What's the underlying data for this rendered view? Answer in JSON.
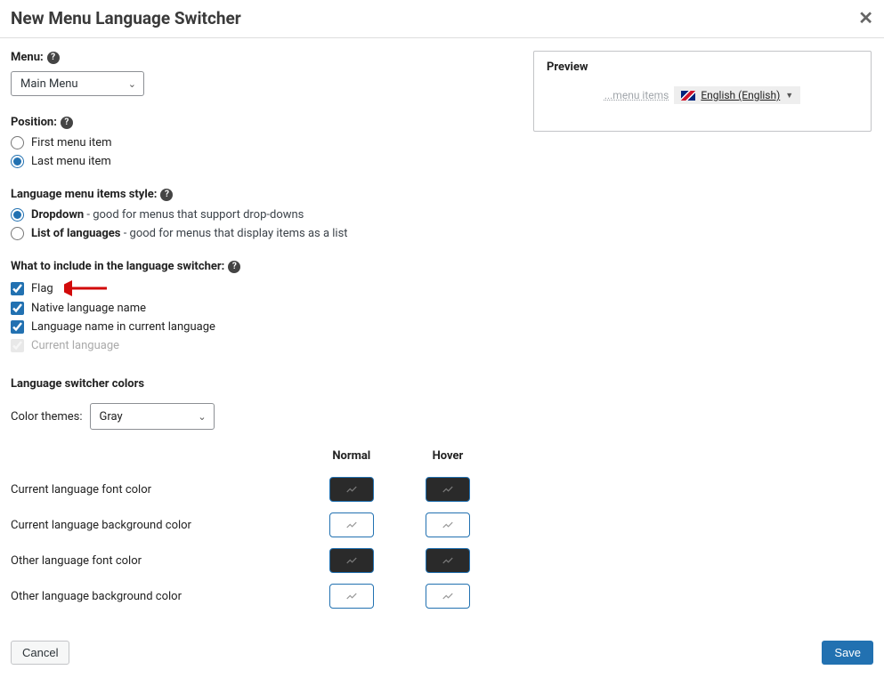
{
  "header": {
    "title": "New Menu Language Switcher"
  },
  "menu": {
    "label": "Menu:",
    "value": "Main Menu"
  },
  "position": {
    "label": "Position:",
    "options": {
      "first": "First menu item",
      "last": "Last menu item"
    },
    "selected": "last"
  },
  "style": {
    "label": "Language menu items style:",
    "options": {
      "dropdown": {
        "name": "Dropdown",
        "desc": " - good for menus that support drop-downs"
      },
      "list": {
        "name": "List of languages",
        "desc": " - good for menus that display items as a list"
      }
    },
    "selected": "dropdown"
  },
  "include": {
    "label": "What to include in the language switcher:",
    "flag": {
      "label": "Flag",
      "checked": true
    },
    "native": {
      "label": "Native language name",
      "checked": true
    },
    "current_lang_name": {
      "label": "Language name in current language",
      "checked": true
    },
    "current_lang": {
      "label": "Current language",
      "checked": true,
      "disabled": true
    }
  },
  "colors": {
    "heading": "Language switcher colors",
    "theme_label": "Color themes:",
    "theme_value": "Gray",
    "columns": {
      "normal": "Normal",
      "hover": "Hover"
    },
    "rows": {
      "current_font": "Current language font color",
      "current_bg": "Current language background color",
      "other_font": "Other language font color",
      "other_bg": "Other language background color"
    }
  },
  "preview": {
    "title": "Preview",
    "placeholder": "...menu items",
    "language_text": "English (English)"
  },
  "footer": {
    "cancel": "Cancel",
    "save": "Save"
  }
}
